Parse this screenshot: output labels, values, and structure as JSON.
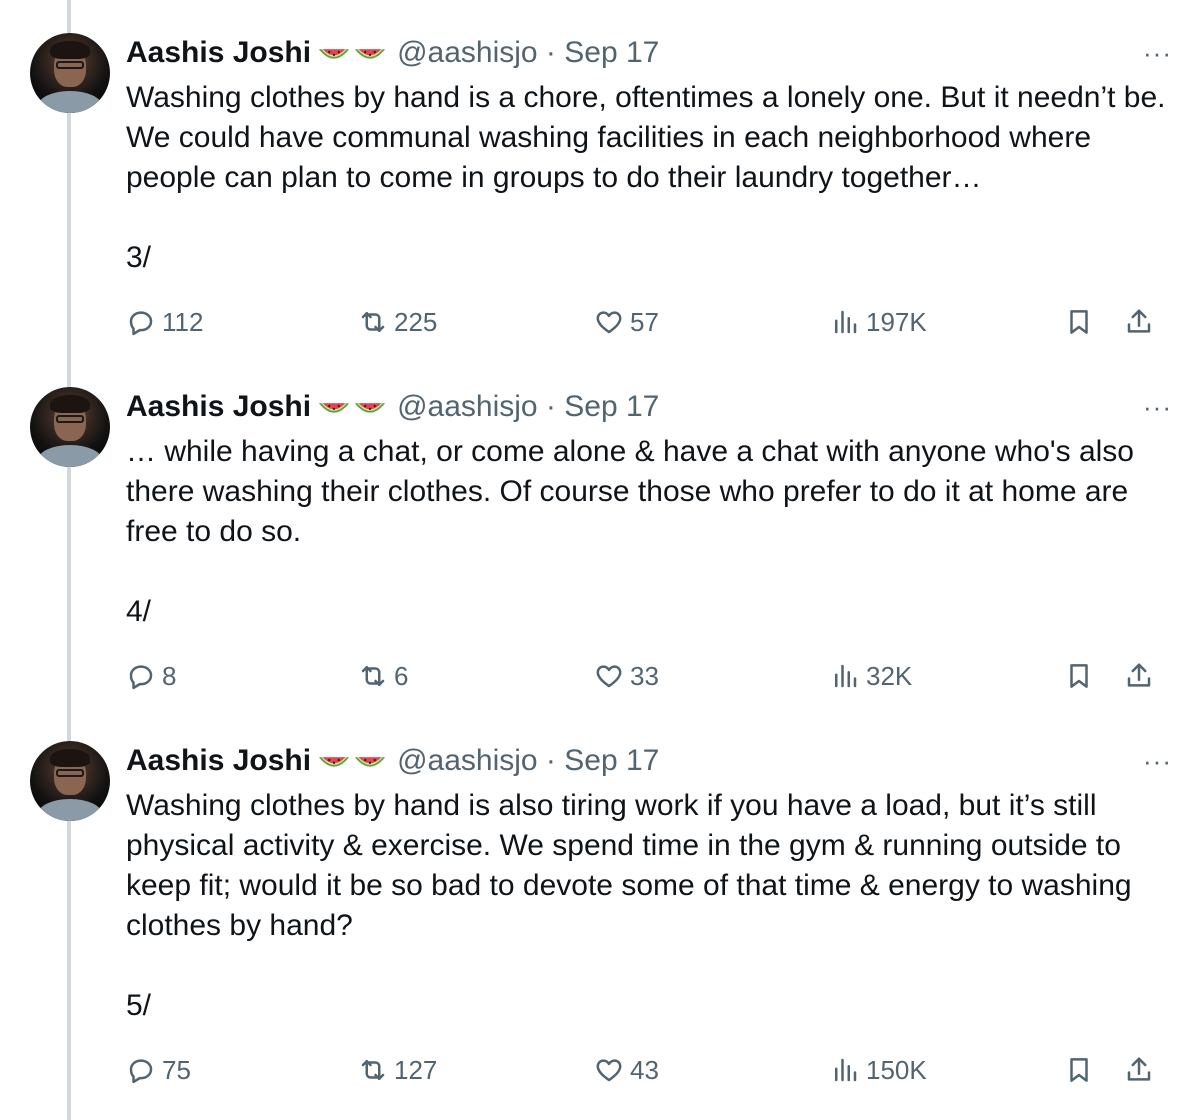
{
  "tweets": [
    {
      "author_name": "Aashis Joshi",
      "handle_date": "@aashisjo · Sep 17",
      "text": "Washing clothes by hand is a chore, oftentimes a lonely one. But it needn’t be. We could have communal washing facilities in each neighborhood where people can plan to come in groups to do their laundry together…",
      "thread_number": "3/",
      "replies": "112",
      "reposts": "225",
      "likes": "57",
      "views": "197K",
      "more": "···"
    },
    {
      "author_name": "Aashis Joshi",
      "handle_date": "@aashisjo · Sep 17",
      "text": "… while having a chat, or come alone & have a chat with anyone who's also there washing their clothes. Of course those who prefer to do it at home are free to do so.",
      "thread_number": "4/",
      "replies": "8",
      "reposts": "6",
      "likes": "33",
      "views": "32K",
      "more": "···"
    },
    {
      "author_name": "Aashis Joshi",
      "handle_date": "@aashisjo · Sep 17",
      "text": "Washing clothes by hand is also tiring work if you have a load, but it’s still physical activity & exercise. We spend time in the gym & running outside to keep fit; would it be so bad to devote some of that time & energy to washing clothes by hand?",
      "thread_number": "5/",
      "replies": "75",
      "reposts": "127",
      "likes": "43",
      "views": "150K",
      "more": "···"
    }
  ],
  "icons": {
    "name_emoji": "watermelon-icon",
    "reply": "reply-icon",
    "repost": "repost-icon",
    "like": "heart-icon",
    "views": "views-icon",
    "bookmark": "bookmark-icon",
    "share": "share-icon"
  },
  "colors": {
    "text": "#0f1419",
    "secondary": "#536471",
    "thread_line": "#cfd9de",
    "background": "#ffffff"
  }
}
